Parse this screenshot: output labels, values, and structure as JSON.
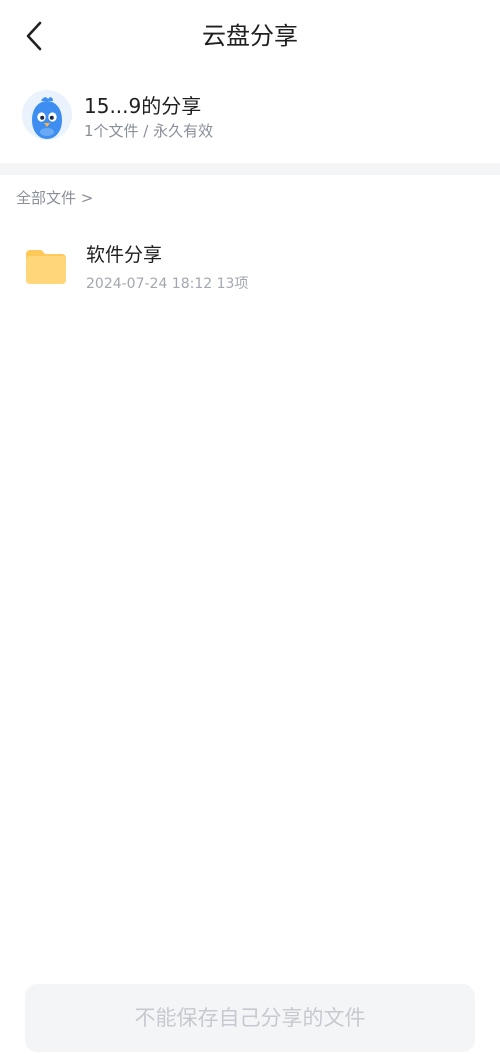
{
  "header": {
    "title": "云盘分享",
    "back_icon": "chevron-left-icon"
  },
  "share": {
    "title": "15...9的分享",
    "subtitle": "1个文件 / 永久有效",
    "avatar_icon": "bird-avatar-icon"
  },
  "breadcrumb": {
    "label": "全部文件 >"
  },
  "files": [
    {
      "name": "软件分享",
      "meta": "2024-07-24 18:12 13项",
      "icon": "folder-icon",
      "icon_color": "#ffcf6b"
    }
  ],
  "footer": {
    "save_label": "不能保存自己分享的文件"
  },
  "colors": {
    "background": "#ffffff",
    "divider": "#f4f5f7",
    "muted_text": "#8a8f99",
    "disabled_button_bg": "#f4f5f7",
    "disabled_button_text": "#c6c9cf",
    "avatar_blue": "#3d8ef0"
  }
}
